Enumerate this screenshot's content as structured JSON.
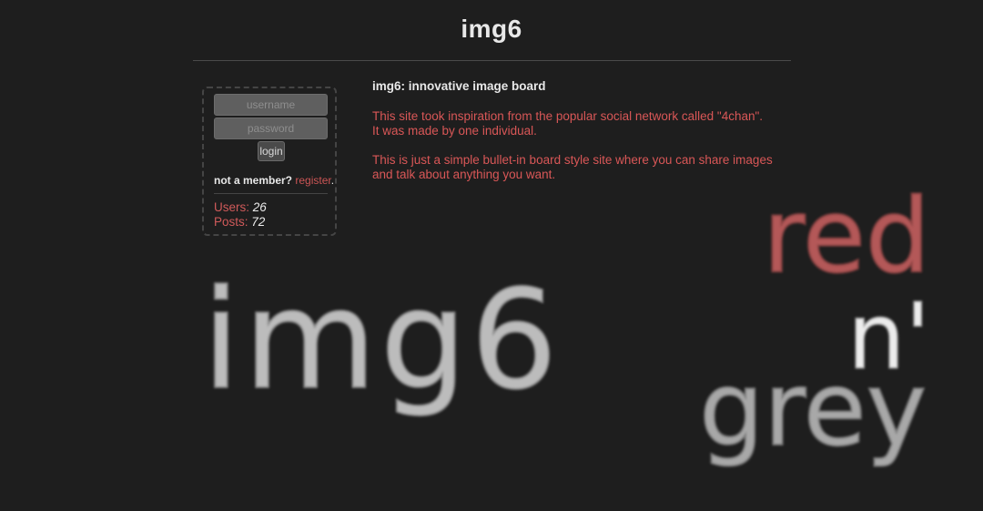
{
  "header": {
    "title": "img6"
  },
  "login": {
    "username_placeholder": "username",
    "password_placeholder": "password",
    "login_label": "login",
    "not_member_text": "not a member?",
    "register_link": "register",
    "period": "."
  },
  "stats": {
    "users_label": "Users:",
    "users_value": "26",
    "posts_label": "Posts:",
    "posts_value": "72"
  },
  "content": {
    "heading": "img6: innovative image board",
    "para1_line1": "This site took inspiration from the popular social network called \"4chan\".",
    "para1_line2": "It was made by one individual.",
    "para2": "This is just a simple bullet-in board style site where you can share images and talk about anything you want."
  },
  "art": {
    "logo_text": "img6",
    "tagline_red": "red",
    "tagline_n": "n'",
    "tagline_grey": "grey",
    "colors": {
      "background": "#1e1e1e",
      "accent_red": "#d95757",
      "art_red": "#b85a5a",
      "art_grey": "#bdbdbd"
    }
  }
}
